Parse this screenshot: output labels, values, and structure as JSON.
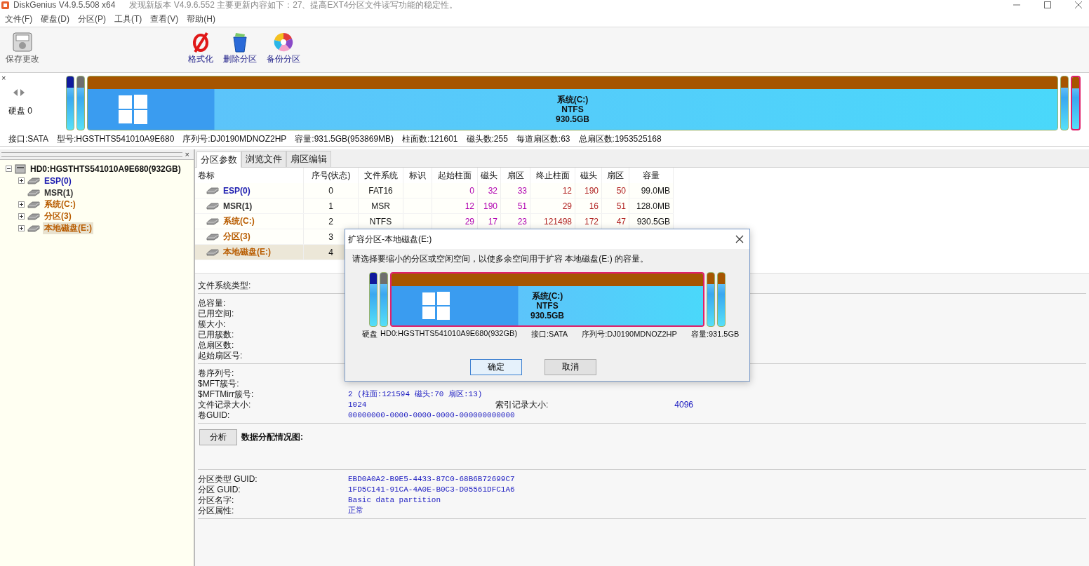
{
  "window": {
    "title": "DiskGenius V4.9.5.508 x64",
    "notice": "发现新版本 V4.9.6.552 主要更新内容如下：27、提高EXT4分区文件读写功能的稳定性。"
  },
  "menu": [
    "文件(F)",
    "硬盘(D)",
    "分区(P)",
    "工具(T)",
    "查看(V)",
    "帮助(H)"
  ],
  "toolbar": [
    {
      "label": "保存更改",
      "kind": "save"
    },
    {
      "label": "格式化",
      "kind": "format"
    },
    {
      "label": "删除分区",
      "kind": "delete"
    },
    {
      "label": "备份分区",
      "kind": "backup"
    }
  ],
  "disk_map": {
    "close": "×",
    "disk_label": "硬盘 0",
    "partitions": [
      {
        "kind": "small",
        "color": "#101a9c",
        "selected": false
      },
      {
        "kind": "small",
        "color": "#6e6e6e",
        "selected": false
      },
      {
        "kind": "main",
        "color": "#a65500",
        "name": "系统(C:)",
        "fs": "NTFS",
        "size": "930.5GB",
        "selected": false
      },
      {
        "kind": "small",
        "color": "#a65500",
        "selected": false
      },
      {
        "kind": "small",
        "color": "#a65500",
        "selected": true
      }
    ]
  },
  "disk_info": [
    "接口:SATA",
    "型号:HGSTHTS541010A9E680",
    "序列号:DJ0190MDNOZ2HP",
    "容量:931.5GB(953869MB)",
    "柱面数:121601",
    "磁头数:255",
    "每道扇区数:63",
    "总扇区数:1953525168"
  ],
  "tree": {
    "close": "×",
    "root": {
      "label": "HD0:HGSTHTS541010A9E680(932GB)",
      "expanded": true,
      "children": [
        {
          "label": "ESP(0)",
          "color": "#1c1cb0",
          "expandable": true,
          "expanded": false,
          "selected": false
        },
        {
          "label": "MSR(1)",
          "color": "#333333",
          "expandable": false,
          "selected": false
        },
        {
          "label": "系统(C:)",
          "color": "#b85c00",
          "expandable": true,
          "expanded": false,
          "selected": false
        },
        {
          "label": "分区(3)",
          "color": "#b85c00",
          "expandable": true,
          "expanded": false,
          "selected": false
        },
        {
          "label": "本地磁盘(E:)",
          "color": "#b85c00",
          "expandable": true,
          "expanded": false,
          "selected": true
        }
      ]
    }
  },
  "tabs": [
    {
      "label": "分区参数",
      "selected": true
    },
    {
      "label": "浏览文件",
      "selected": false
    },
    {
      "label": "扇区编辑",
      "selected": false
    }
  ],
  "table": {
    "columns": [
      "卷标",
      "序号(状态)",
      "文件系统",
      "标识",
      "起始柱面",
      "磁头",
      "扇区",
      "终止柱面",
      "磁头",
      "扇区",
      "容量"
    ],
    "rows": [
      {
        "color": "#1c1cb0",
        "selected": false,
        "cells": [
          "ESP(0)",
          "0",
          "FAT16",
          null,
          "0",
          "32",
          "33",
          "12",
          "190",
          "50",
          "99.0MB"
        ]
      },
      {
        "color": "#333333",
        "selected": false,
        "cells": [
          "MSR(1)",
          "1",
          "MSR",
          null,
          "12",
          "190",
          "51",
          "29",
          "16",
          "51",
          "128.0MB"
        ]
      },
      {
        "color": "#b85c00",
        "selected": false,
        "cells": [
          "系统(C:)",
          "2",
          "NTFS",
          null,
          "29",
          "17",
          "23",
          "121498",
          "172",
          "47",
          "930.5GB"
        ]
      },
      {
        "color": "#b85c00",
        "selected": false,
        "cells": [
          "分区(3)",
          "3"
        ]
      },
      {
        "color": "#b85c00",
        "selected": true,
        "cells": [
          "本地磁盘(E:)",
          "4"
        ]
      }
    ]
  },
  "details": [
    {
      "kind": "fields",
      "fields": [
        {
          "label": "文件系统类型:"
        }
      ]
    },
    {
      "kind": "fields",
      "fields": [
        {
          "label": "总容量:"
        },
        {
          "label": "已用空间:"
        },
        {
          "label": "簇大小:"
        },
        {
          "label": "已用簇数:"
        },
        {
          "label": "总扇区数:"
        },
        {
          "label": "起始扇区号:"
        }
      ]
    },
    {
      "kind": "fields",
      "fields": [
        {
          "label": "卷序列号:"
        },
        {
          "label": "$MFT簇号:"
        },
        {
          "label": "$MFTMirr簇号:",
          "value": "2 (柱面:121594 磁头:70 扇区:13)"
        },
        {
          "label": "文件记录大小:",
          "value": "1024",
          "extra_label": "索引记录大小:",
          "extra_value": "4096"
        },
        {
          "label": "卷GUID:",
          "value": "00000000-0000-0000-0000-000000000000"
        }
      ]
    },
    {
      "kind": "analysis",
      "button": "分析",
      "label": "数据分配情况图:"
    },
    {
      "kind": "fields",
      "fields": [
        {
          "label": "分区类型 GUID:",
          "value": "EBD0A0A2-B9E5-4433-87C0-68B6B72699C7"
        },
        {
          "label": "分区 GUID:",
          "value": "1FD5C141-91CA-4A0E-B0C3-D05561DFC1A6"
        },
        {
          "label": "分区名字:",
          "value": "Basic data partition"
        },
        {
          "label": "分区属性:",
          "value": "正常"
        }
      ]
    }
  ],
  "dialog": {
    "title": "扩容分区-本地磁盘(E:)",
    "message": "请选择要缩小的分区或空闲空间，以使多余空间用于扩容 本地磁盘(E:) 的容量。",
    "partitions": [
      {
        "kind": "small",
        "color": "#101a9c",
        "selected": false
      },
      {
        "kind": "small",
        "color": "#6e6e6e",
        "selected": false
      },
      {
        "kind": "main",
        "color": "#a65500",
        "name": "系统(C:)",
        "fs": "NTFS",
        "size": "930.5GB",
        "selected": true
      },
      {
        "kind": "small",
        "color": "#a65500",
        "selected": false
      },
      {
        "kind": "small",
        "color": "#a65500",
        "selected": false
      }
    ],
    "disk_label": "硬盘",
    "info": [
      "HD0:HGSTHTS541010A9E680(932GB)",
      "接口:SATA",
      "序列号:DJ0190MDNOZ2HP",
      "容量:931.5GB"
    ],
    "buttons": [
      {
        "label": "确定",
        "selected": true
      },
      {
        "label": "取消",
        "selected": false
      }
    ]
  }
}
